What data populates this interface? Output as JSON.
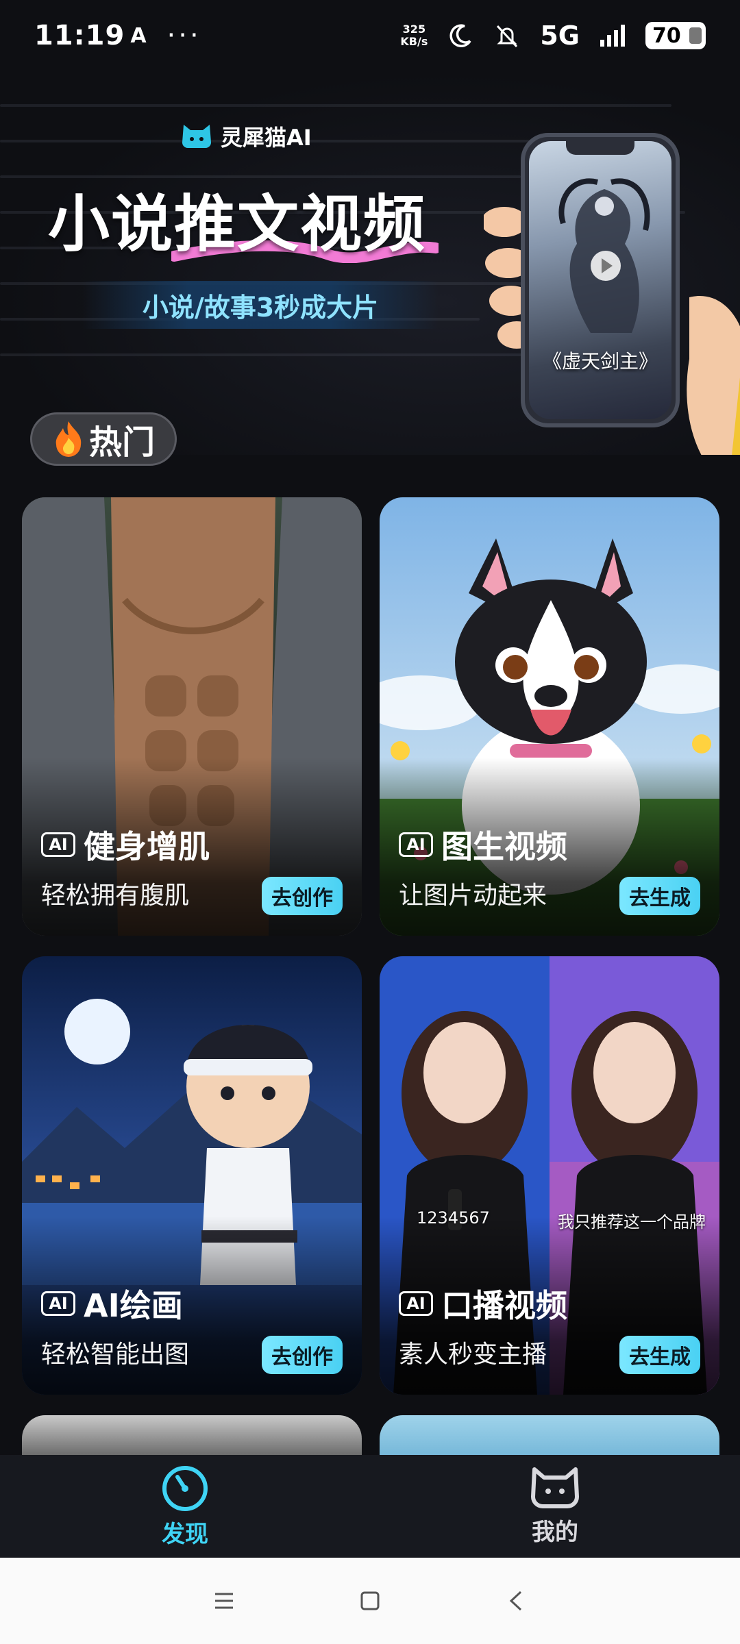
{
  "status_bar": {
    "time": "11:19",
    "extra_icon": "A",
    "dots": "···",
    "speed_value": "325",
    "speed_unit": "KB/s",
    "network": "5G",
    "battery": "70"
  },
  "banner": {
    "brand_name": "灵犀猫AI",
    "headline": "小说推文视频",
    "subtitle": "小说/故事3秒成大片",
    "phone_caption": "《虚天剑主》"
  },
  "section": {
    "hot_label": "热门",
    "hot_icon": "fire-icon"
  },
  "cards": [
    {
      "badge": "AI",
      "title": "健身增肌",
      "desc": "轻松拥有腹肌",
      "button": "去创作"
    },
    {
      "badge": "AI",
      "title": "图生视频",
      "desc": "让图片动起来",
      "button": "去生成"
    },
    {
      "badge": "AI",
      "title": "AI绘画",
      "desc": "轻松智能出图",
      "button": "去创作"
    },
    {
      "badge": "AI",
      "title": "口播视频",
      "desc": "素人秒变主播",
      "button": "去生成",
      "overlay_left": "1234567",
      "overlay_right": "我只推荐这一个品牌"
    }
  ],
  "bottom_nav": [
    {
      "label": "发现",
      "icon": "compass-icon",
      "active": true
    },
    {
      "label": "我的",
      "icon": "cat-icon",
      "active": false
    }
  ],
  "colors": {
    "accent": "#3fd4f5",
    "background": "#0e0f13",
    "button": "#4ad1f3"
  }
}
